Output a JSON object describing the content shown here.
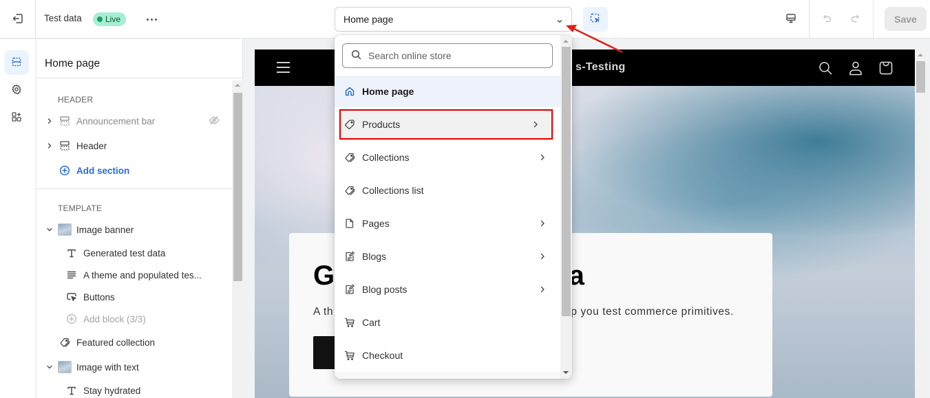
{
  "topbar": {
    "theme_name": "Test data",
    "status_badge": "Live",
    "page_selector_value": "Home page",
    "save_label": "Save"
  },
  "sidebar": {
    "title": "Home page",
    "header_section_label": "HEADER",
    "header_items": [
      {
        "label": "Announcement bar",
        "hidden": true
      },
      {
        "label": "Header",
        "hidden": false
      }
    ],
    "add_section_label": "Add section",
    "template_section_label": "TEMPLATE",
    "template_items": [
      {
        "label": "Image banner",
        "expanded": true
      },
      {
        "label": "Generated test data",
        "type": "text-block"
      },
      {
        "label": "A theme and populated tes...",
        "type": "paragraph-block"
      },
      {
        "label": "Buttons",
        "type": "buttons-block"
      },
      {
        "label": "Add block (3/3)",
        "type": "add-block",
        "disabled": true
      },
      {
        "label": "Featured collection"
      },
      {
        "label": "Image with text",
        "expanded": true
      },
      {
        "label": "Stay hydrated",
        "type": "text-block"
      }
    ]
  },
  "dropdown": {
    "search_placeholder": "Search online store",
    "items": [
      {
        "label": "Home page",
        "icon": "home-icon",
        "selected": true,
        "has_submenu": false
      },
      {
        "label": "Products",
        "icon": "tag-icon",
        "highlighted": true,
        "has_submenu": true
      },
      {
        "label": "Collections",
        "icon": "tags-icon",
        "has_submenu": true
      },
      {
        "label": "Collections list",
        "icon": "tags-icon",
        "has_submenu": false
      },
      {
        "label": "Pages",
        "icon": "page-icon",
        "has_submenu": true
      },
      {
        "label": "Blogs",
        "icon": "blog-icon",
        "has_submenu": true
      },
      {
        "label": "Blog posts",
        "icon": "blog-icon",
        "has_submenu": true
      },
      {
        "label": "Cart",
        "icon": "cart-icon",
        "has_submenu": false
      },
      {
        "label": "Checkout",
        "icon": "cart-icon",
        "has_submenu": false
      }
    ]
  },
  "preview": {
    "store_name": "s-Testing",
    "hero_title_left": "G",
    "hero_title_right": "a",
    "hero_sub_left": "A th",
    "hero_sub_right": "elp you test commerce primitives."
  },
  "colors": {
    "accent": "#2c6ecb",
    "live_badge_bg": "#a6efd2",
    "highlight_box": "#e20000",
    "annotation_arrow": "#e01e1e"
  }
}
